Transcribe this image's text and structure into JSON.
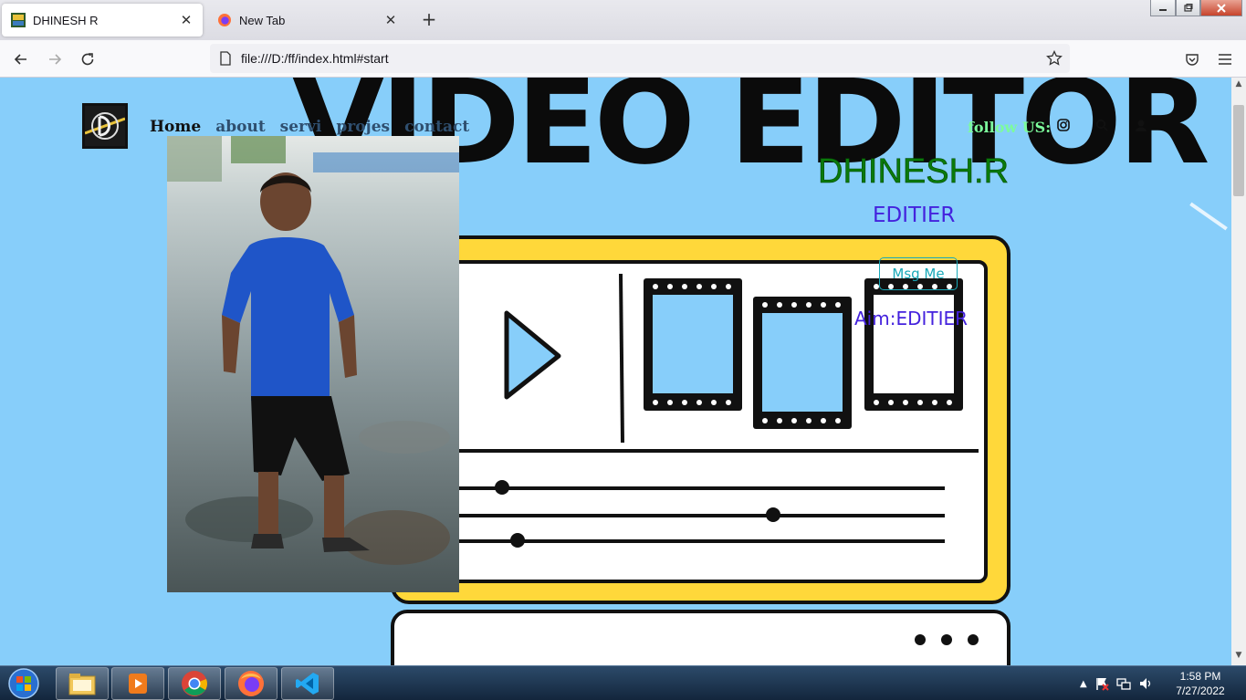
{
  "browser": {
    "tabs": [
      {
        "label": "DHINESH R",
        "active": true
      },
      {
        "label": "New Tab",
        "active": false
      }
    ],
    "new_tab_symbol": "+",
    "close_symbol": "✕",
    "url": "file:///D:/ff/index.html#start"
  },
  "page": {
    "background_title": "VIDEO EDITOR",
    "nav": {
      "items": [
        "Home",
        "about",
        "servi",
        "projes",
        "contact"
      ]
    },
    "follow_label": "follow US:",
    "profile": {
      "name": "DHINESH.R",
      "role": "EDITIER",
      "button_label": "Msg Me",
      "aim": "Aim:EDITIER"
    },
    "colors": {
      "page_background": "#87cefa",
      "name": "#0a7a0a",
      "role": "#4422dd",
      "button": "#18a8b8",
      "follow": "#7cfc9c",
      "illustration_yellow": "#ffd83a"
    }
  },
  "taskbar": {
    "apps": [
      "file-explorer-icon",
      "media-player-icon",
      "chrome-icon",
      "firefox-icon",
      "vscode-icon"
    ],
    "time": "1:58 PM",
    "date": "7/27/2022"
  }
}
